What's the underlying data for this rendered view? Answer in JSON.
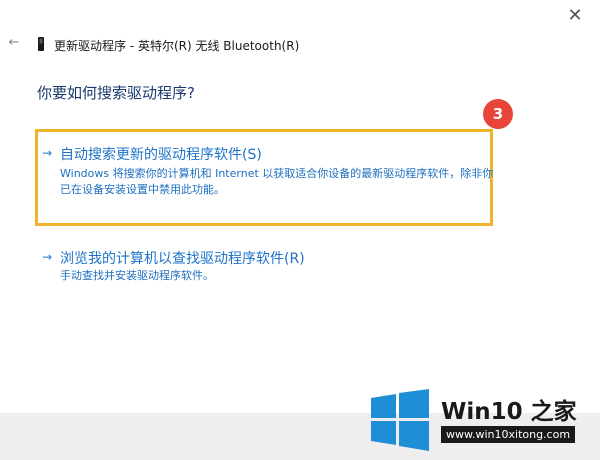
{
  "window": {
    "title": "更新驱动程序 - 英特尔(R) 无线 Bluetooth(R)",
    "close_glyph": "✕",
    "back_glyph": "←"
  },
  "heading": "你要如何搜索驱动程序?",
  "step_marker": "3",
  "options": [
    {
      "arrow": "→",
      "title": "自动搜索更新的驱动程序软件(S)",
      "description": "Windows 将搜索你的计算机和 Internet 以获取适合你设备的最新驱动程序软件，除非你已在设备安装设置中禁用此功能。"
    },
    {
      "arrow": "→",
      "title": "浏览我的计算机以查找驱动程序软件(R)",
      "description": "手动查找并安装驱动程序软件。"
    }
  ],
  "watermark": {
    "brand": "Win10 之家",
    "url": "www.win10xitong.com"
  },
  "colors": {
    "link": "#1e73c8",
    "highlight": "#f0b428",
    "marker": "#e8443a",
    "logo": "#1e8fd6"
  },
  "icons": [
    "close-icon",
    "back-arrow-icon",
    "device-icon",
    "arrow-right-icon",
    "windows-logo-icon"
  ]
}
